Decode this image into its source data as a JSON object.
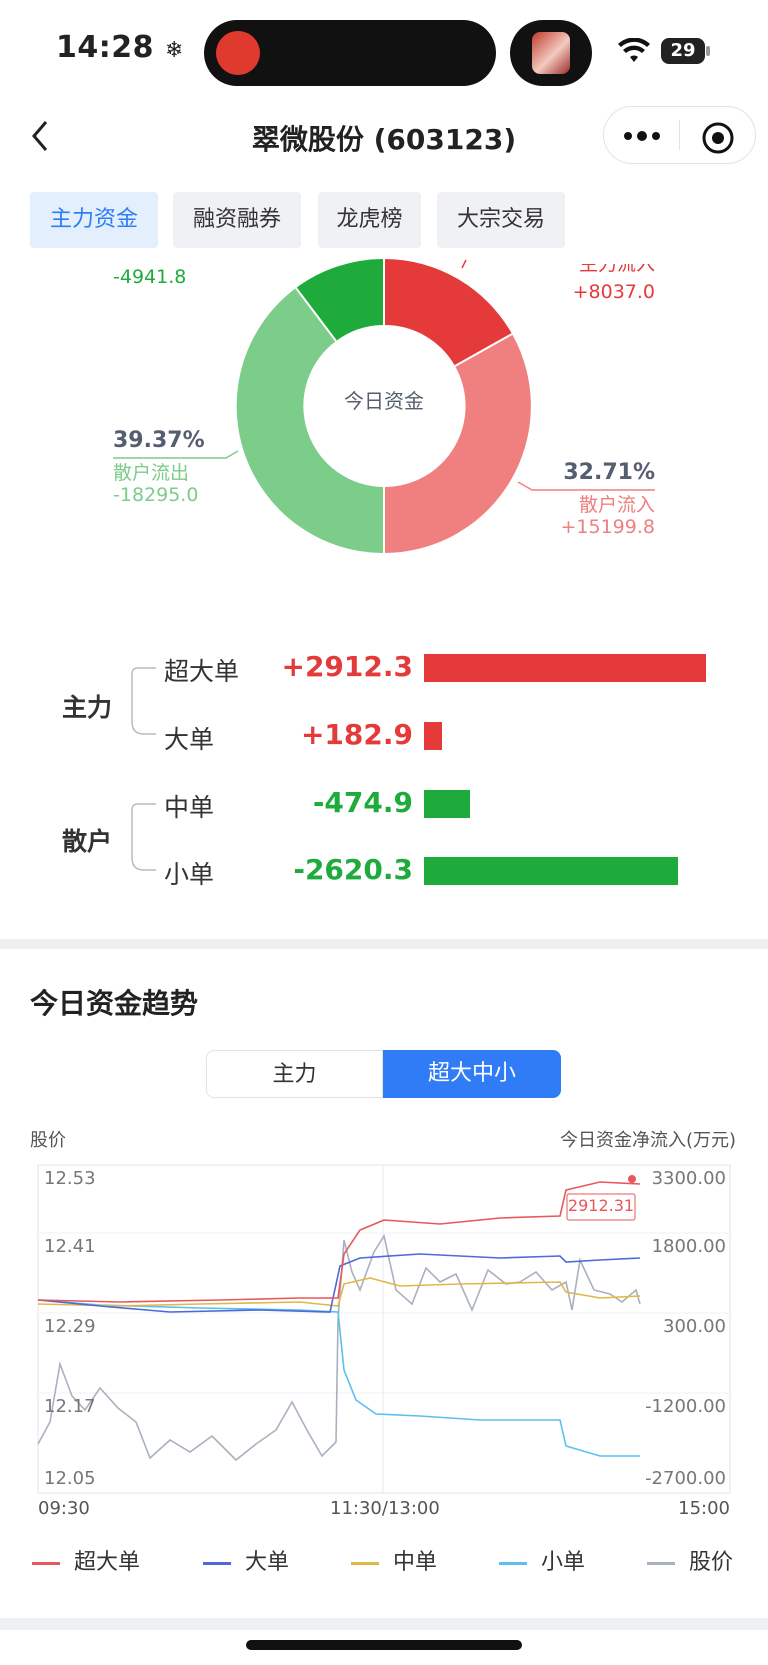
{
  "status": {
    "time": "14:28",
    "snow_icon": "❄",
    "battery": "29"
  },
  "nav": {
    "title": "翠微股份 (603123)"
  },
  "tabs": [
    {
      "label": "主力资金",
      "active": true
    },
    {
      "label": "融资融券",
      "active": false
    },
    {
      "label": "龙虎榜",
      "active": false
    },
    {
      "label": "大宗交易",
      "active": false
    }
  ],
  "donut": {
    "center_label": "今日资金",
    "top_left_value": "-4941.8",
    "top_right_label": "主力流入",
    "top_right_value": "+8037.0",
    "left_pct": "39.37%",
    "left_label": "散户流出",
    "left_value": "-18295.0",
    "right_pct": "32.71%",
    "right_label": "散户流入",
    "right_value": "+15199.8",
    "colors": {
      "main_in": "#e53a3a",
      "retail_in": "#f07f7f",
      "retail_out": "#7ccc8a",
      "main_out": "#1fab3c"
    }
  },
  "flows": {
    "group_main": "主力",
    "group_retail": "散户",
    "rows": [
      {
        "label": "超大单",
        "value": "+2912.3",
        "num": 2912.3
      },
      {
        "label": "大单",
        "value": "+182.9",
        "num": 182.9
      },
      {
        "label": "中单",
        "value": "-474.9",
        "num": -474.9
      },
      {
        "label": "小单",
        "value": "-2620.3",
        "num": -2620.3
      }
    ]
  },
  "trend": {
    "title": "今日资金趋势",
    "segments": [
      {
        "label": "主力",
        "active": false
      },
      {
        "label": "超大中小",
        "active": true
      }
    ],
    "left_axis_title": "股价",
    "right_axis_title": "今日资金净流入(万元)",
    "left_ticks": [
      "12.53",
      "12.41",
      "12.29",
      "12.17",
      "12.05"
    ],
    "right_ticks": [
      "3300.00",
      "1800.00",
      "300.00",
      "-1200.00",
      "-2700.00"
    ],
    "x_ticks": [
      "09:30",
      "11:30/13:00",
      "15:00"
    ],
    "tooltip": "2912.31",
    "legend": [
      {
        "label": "超大单",
        "color": "#e8575a"
      },
      {
        "label": "大单",
        "color": "#4e6ad8"
      },
      {
        "label": "中单",
        "color": "#e0b84a"
      },
      {
        "label": "小单",
        "color": "#5bbfef"
      },
      {
        "label": "股价",
        "color": "#a9b0bf"
      }
    ]
  },
  "colors": {
    "red": "#e53a3a",
    "green": "#1fab3c",
    "blue": "#2f7cf6"
  }
}
